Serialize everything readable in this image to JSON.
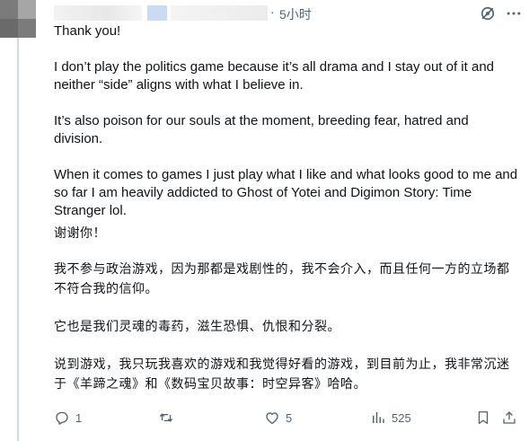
{
  "header": {
    "dot": "·",
    "timestamp": "5小时"
  },
  "icons": {
    "grok": "grok-icon",
    "more": "more-horizontal-icon",
    "reply": "reply-icon",
    "repost": "repost-icon",
    "like": "like-icon",
    "views": "views-icon",
    "bookmark": "bookmark-icon",
    "share": "share-icon"
  },
  "post": {
    "paragraphs_en": [
      "Thank you!",
      "I don’t play the politics game because it’s all drama and I stay out of it and neither “side” aligns with what I believe in.",
      "It’s also poison for our souls at the moment, breeding fear, hatred and division.",
      "When it comes to games I just play what I like and what looks good to me and so far I am heavily addicted to Ghost of Yotei and Digimon Story: Time Stranger lol."
    ],
    "paragraphs_cn": [
      "谢谢你！",
      "我不参与政治游戏，因为那都是戏剧性的，我不会介入，而且任何一方的立场都不符合我的信仰。",
      "它也是我们灵魂的毒药，滋生恐惧、仇恨和分裂。",
      "说到游戏，我只玩我喜欢的游戏和我觉得好看的游戏，到目前为止，我非常沉迷于《羊蹄之魂》和《数码宝贝故事：时空异客》哈哈。"
    ]
  },
  "actions": {
    "reply_count": "1",
    "repost_count": "",
    "like_count": "5",
    "views_count": "525"
  },
  "colors": {
    "text": "#0f1419",
    "muted": "#536471",
    "thread": "#cfd9de"
  }
}
